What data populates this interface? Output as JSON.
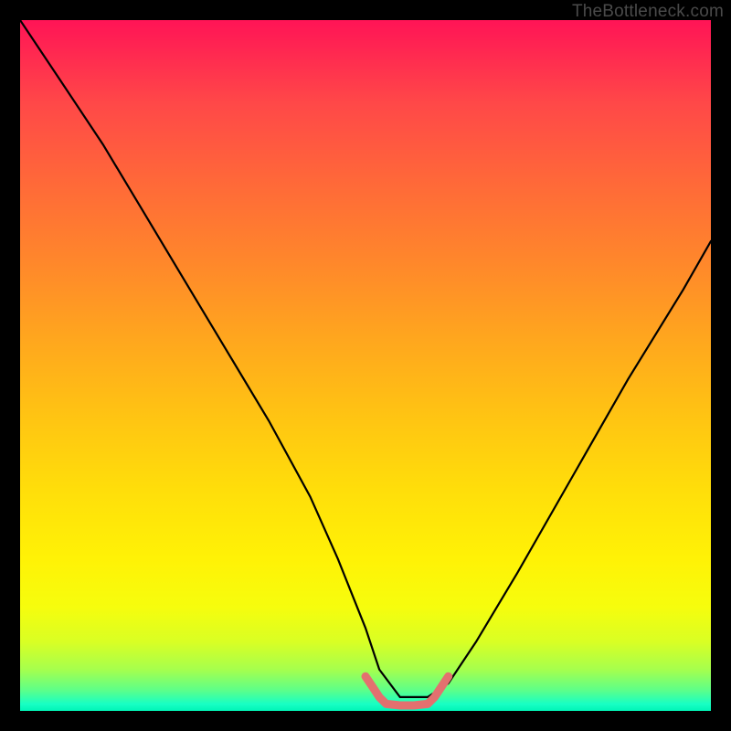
{
  "watermark": "TheBottleneck.com",
  "chart_data": {
    "type": "line",
    "title": "",
    "xlabel": "",
    "ylabel": "",
    "xlim": [
      0,
      100
    ],
    "ylim": [
      0,
      100
    ],
    "grid": false,
    "legend": false,
    "series": [
      {
        "name": "bottleneck-curve",
        "color": "#000000",
        "x": [
          0,
          6,
          12,
          18,
          24,
          30,
          36,
          42,
          46,
          50,
          52,
          55,
          59,
          62,
          66,
          72,
          80,
          88,
          96,
          100
        ],
        "y": [
          100,
          91,
          82,
          72,
          62,
          52,
          42,
          31,
          22,
          12,
          6,
          2,
          2,
          4,
          10,
          20,
          34,
          48,
          61,
          68
        ]
      },
      {
        "name": "highlight-band",
        "color": "#e3706f",
        "x": [
          50,
          51,
          52,
          53,
          55,
          57,
          59,
          60,
          61,
          62
        ],
        "y": [
          5,
          3.5,
          2,
          1,
          0.8,
          0.8,
          1,
          2,
          3.5,
          5
        ]
      }
    ],
    "gradient_stops": [
      {
        "pos": 0,
        "color": "#ff1456"
      },
      {
        "pos": 12,
        "color": "#ff4848"
      },
      {
        "pos": 35,
        "color": "#ff872b"
      },
      {
        "pos": 57,
        "color": "#ffc313"
      },
      {
        "pos": 78,
        "color": "#fff206"
      },
      {
        "pos": 94,
        "color": "#a6ff4d"
      },
      {
        "pos": 100,
        "color": "#00f5b7"
      }
    ]
  }
}
